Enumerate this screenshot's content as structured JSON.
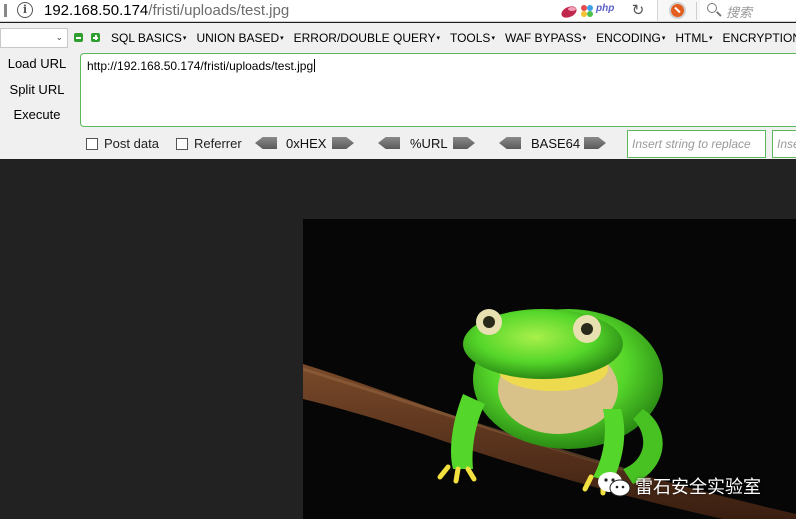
{
  "address_bar": {
    "url_host": "192.168.50.174",
    "url_path": "/fristi/uploads/test.jpg",
    "php_badge": "php",
    "search_placeholder": "搜索"
  },
  "hackbar": {
    "menus": [
      {
        "label": "SQL BASICS"
      },
      {
        "label": "UNION BASED"
      },
      {
        "label": "ERROR/DOUBLE QUERY"
      },
      {
        "label": "TOOLS"
      },
      {
        "label": "WAF BYPASS"
      },
      {
        "label": "ENCODING"
      },
      {
        "label": "HTML"
      },
      {
        "label": "ENCRYPTION"
      }
    ],
    "load_url": "Load URL",
    "split_url": "Split URL",
    "execute": "Execute",
    "url_value": "http://192.168.50.174/fristi/uploads/test.jpg",
    "post_data_label": "Post data",
    "referrer_label": "Referrer",
    "hex_label": "0xHEX",
    "url_enc_label": "%URL",
    "base64_label": "BASE64",
    "replace_placeholder": "Insert string to replace",
    "replace_with_placeholder": "Insert"
  },
  "watermark": {
    "text": "雷石安全实验室"
  },
  "colors": {
    "accent_green": "#5cb85c",
    "frog_green": "#55d62a",
    "page_bg": "#222222"
  }
}
